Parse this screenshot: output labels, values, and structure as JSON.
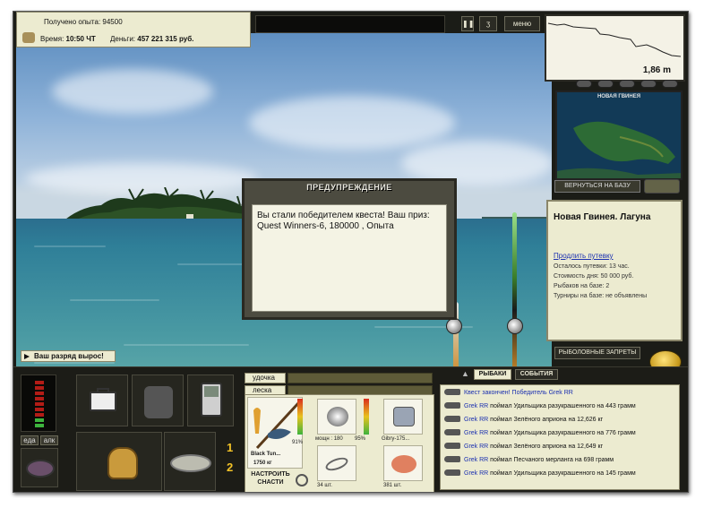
{
  "hud": {
    "experience_label": "Получено опыта: 94500",
    "time_label": "Время:",
    "time_value": "10:50 ЧТ",
    "money_label": "Деньги:",
    "money_value": "457 221 315 руб.",
    "menu_label": "меню",
    "pause_icon": "pause-icon",
    "speed_icon": "speed-icon"
  },
  "depth": {
    "value_label": "1,86 m"
  },
  "map": {
    "title": "НОВАЯ ГВИНЕЯ",
    "return_label": "ВЕРНУТЬСЯ НА БАЗУ"
  },
  "location": {
    "title": "Новая Гвинея. Лагуна",
    "extend_link": "Продлить путевку",
    "lines": [
      "Осталось путевки: 13 час.",
      "Стоимость дня: 50 000 руб.",
      "Рыбаков на базе: 2",
      "Турниры на базе: не объявлены"
    ],
    "bans_label": "РЫБОЛОВНЫЕ ЗАПРЕТЫ"
  },
  "dialog": {
    "title": "ПРЕДУПРЕЖДЕНИЕ",
    "message": "Вы стали победителем квеста! Ваш приз: Quest Winners-6, 180000 , Опыта"
  },
  "rank_notice": "Ваш разряд вырос!",
  "inventory": {
    "food_label": "еда",
    "alcohol_label": "алк",
    "slot_numbers": [
      "1",
      "2"
    ]
  },
  "rod_panel": {
    "rod_tab": "удочка",
    "line_tab": "леска",
    "fish_name": "Black Tun...",
    "fish_weight": "1750 кг",
    "rod_percent": "91%",
    "setup_label": "НАСТРОИТЬ СНАСТИ",
    "reel_caption": "мощн : 180",
    "reel_percent": "95%",
    "line_caption": "Gibry-175...",
    "hook_caption": "34 шт.",
    "bait_caption": "381 шт."
  },
  "log": {
    "tab_fishers": "РЫБАКИ",
    "tab_events": "СОБЫТИЯ",
    "entries": [
      {
        "name": "Квест закончен! Победитель Grek RR",
        "text": ""
      },
      {
        "name": "Grek RR",
        "text": " поймал Удильщика разукрашенного на 443 грамм"
      },
      {
        "name": "Grek RR",
        "text": " поймал Зелёного априона на 12,626 кг"
      },
      {
        "name": "Grek RR",
        "text": " поймал Удильщика разукрашенного на 776 грамм"
      },
      {
        "name": "Grek RR",
        "text": " поймал Зелёного априона на 12,649 кг"
      },
      {
        "name": "Grek RR",
        "text": " поймал Песчаного мерланга на 698 грамм"
      },
      {
        "name": "Grek RR",
        "text": " поймал Удильщика разукрашенного на 145 грамм"
      }
    ]
  }
}
